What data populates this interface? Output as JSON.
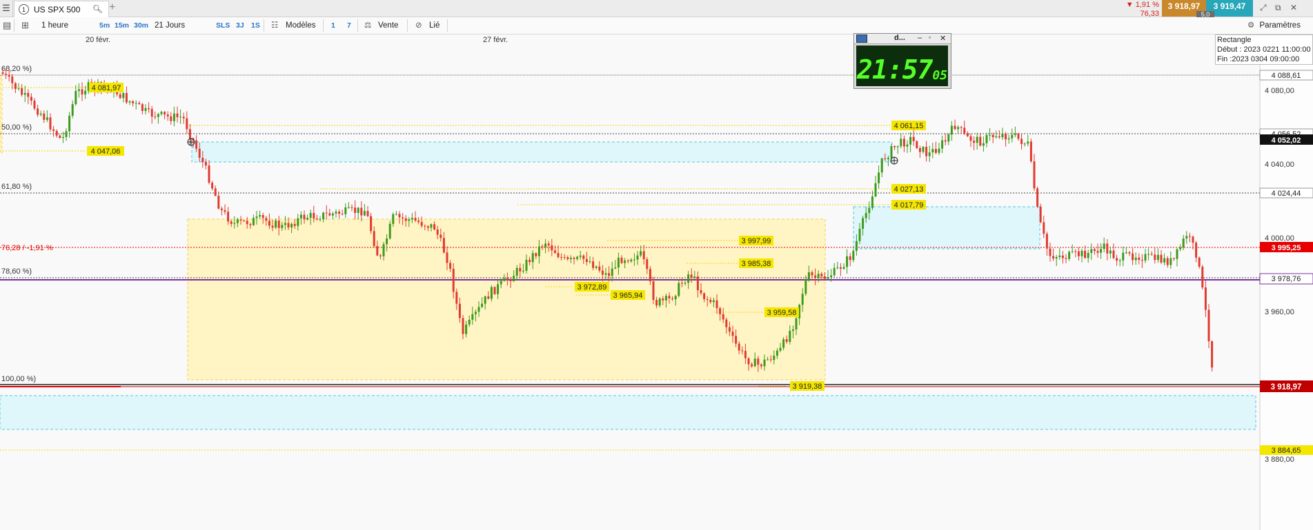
{
  "tabbar": {
    "tab_number": "1",
    "tab_title": "US SPX 500",
    "add_tab": "+",
    "change_pct": "▼ 1,91 %",
    "change_abs": "76,33",
    "bid": "3 918,97",
    "ask": "3 919,47",
    "spread": "5,0"
  },
  "toolbar": {
    "timeframe": "1 heure",
    "quick_tf": [
      "5m",
      "15m",
      "30m"
    ],
    "period": "21 Jours",
    "quick_periods": [
      "SLS",
      "3J",
      "1S"
    ],
    "templates": "Modèles",
    "page_nums": [
      "1",
      "7"
    ],
    "sell": "Vente",
    "linked": "Lié",
    "settings": "Paramètres"
  },
  "chart": {
    "date_labels": [
      "20 févr.",
      "27 févr."
    ],
    "fib_labels": [
      "68,20 %)",
      "50,00 %)",
      "61,80 %)",
      "76,28 / -1,91 %",
      "78,60 %)",
      "100,00 %)"
    ],
    "axis_ticks": [
      "4 080,00",
      "4 040,00",
      "4 000,00",
      "3 960,00",
      "3 880,00"
    ],
    "axis_tags": {
      "level_4088": "4 088,61",
      "level_4056": "4 056,52",
      "current_high": "4 052,02",
      "level_4024": "4 024,44",
      "prev_close": "3 995,25",
      "level_3978": "3 978,76",
      "last_price": "3 918,97",
      "level_3884": "3 884,65"
    },
    "price_labels": [
      "4 081,97",
      "4 047,06",
      "4 061,15",
      "4 027,13",
      "4 017,79",
      "3 997,99",
      "3 985,38",
      "3 972,89",
      "3 965,94",
      "3 959,58",
      "3 919,38"
    ],
    "colors": {
      "up": "#3d9a1b",
      "down": "#e03a2f",
      "fib_yellow": "#f5d800",
      "zone_yellow": "#fff4c4",
      "zone_blue": "#dff6fb",
      "purple_line": "#7a2ea0",
      "price_red": "#e60000"
    }
  },
  "clock": {
    "title": "d...",
    "time": "21:57",
    "seconds": "05"
  },
  "rect_info": {
    "title": "Rectangle",
    "start": "Début : 2023 0221 11:00:00",
    "end": "Fin :2023 0304 09:00:00"
  }
}
